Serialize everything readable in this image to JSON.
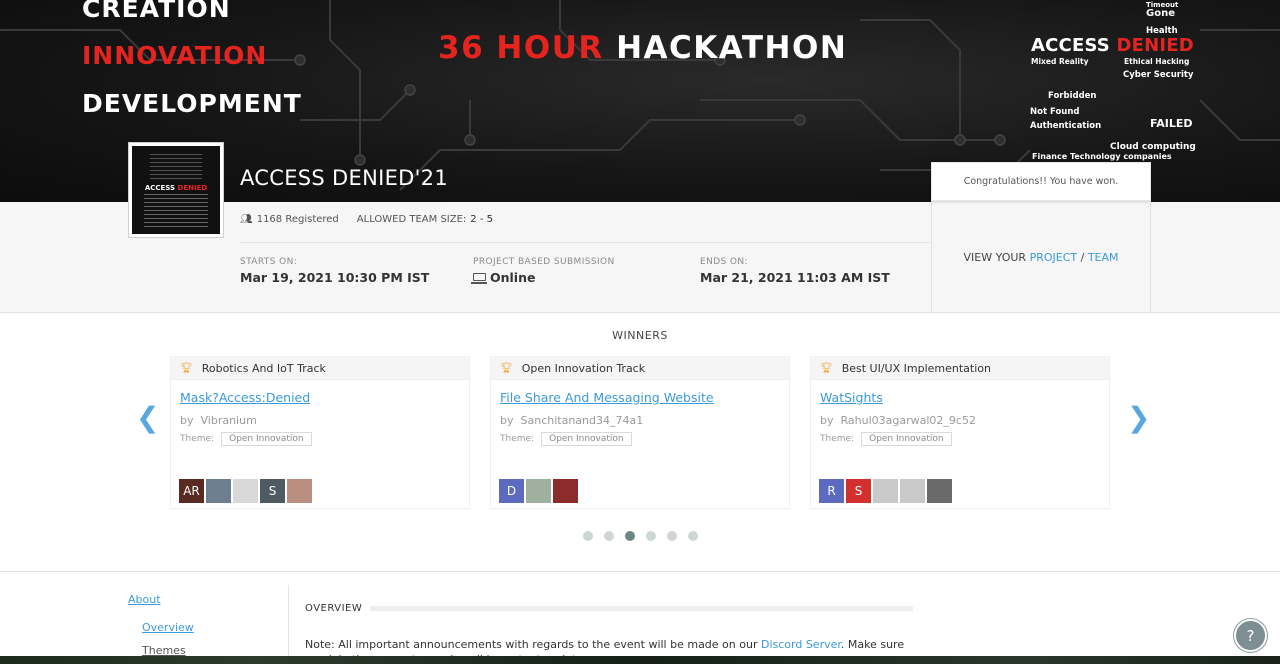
{
  "banner": {
    "tagline": [
      "CREATION",
      "INNOVATION",
      "DEVELOPMENT"
    ],
    "hackathon_number": "36 HOUR",
    "hackathon_word": "HACKATHON",
    "cloud_prefix": "ACCESS",
    "cloud_suffix": "DENIED",
    "cloud_words": [
      "Timeout",
      "Gone",
      "Health",
      "Mixed Reality",
      "Ethical Hacking",
      "Cyber Security",
      "Forbidden",
      "Not Found",
      "FAILED",
      "Authentication",
      "Cloud computing",
      "Finance Technology companies"
    ]
  },
  "event": {
    "name": "ACCESS DENIED'21",
    "logo_text_prefix": "ACCESS",
    "logo_text_suffix": "DENIED",
    "registered": "1168 Registered",
    "team_size_label": "ALLOWED TEAM SIZE:",
    "team_size_value": "2 - 5",
    "starts_label": "STARTS ON:",
    "starts_value": "Mar 19, 2021 10:30 PM IST",
    "submission_label": "PROJECT BASED SUBMISSION",
    "submission_value": "Online",
    "ends_label": "ENDS ON:",
    "ends_value": "Mar 21, 2021 11:03 AM IST"
  },
  "winbox": {
    "message": "Congratulations!! You have won.",
    "view_prefix": "VIEW YOUR",
    "project_link": "PROJECT",
    "separator": "/",
    "team_link": "TEAM"
  },
  "winners": {
    "title": "WINNERS",
    "cards": [
      {
        "track": "Robotics And IoT Track",
        "project": "Mask?Access:Denied",
        "by_label": "by",
        "author": "Vibranium",
        "theme_label": "Theme:",
        "theme": "Open Innovation",
        "avatars": [
          {
            "letter": "AR",
            "color": "#5a2a22"
          },
          {
            "letter": "",
            "color": "#6d7f8f"
          },
          {
            "letter": "",
            "color": "#d8d8d8"
          },
          {
            "letter": "S",
            "color": "#4f5b62"
          },
          {
            "letter": "",
            "color": "#b88f80"
          }
        ]
      },
      {
        "track": "Open Innovation Track",
        "project": "File Share And Messaging Website",
        "by_label": "by",
        "author": "Sanchitanand34_74a1",
        "theme_label": "Theme:",
        "theme": "Open Innovation",
        "avatars": [
          {
            "letter": "D",
            "color": "#5c6bc0"
          },
          {
            "letter": "",
            "color": "#9fb0a0"
          },
          {
            "letter": "",
            "color": "#8b2b2b"
          }
        ]
      },
      {
        "track": "Best UI/UX Implementation",
        "project": "WatSights",
        "by_label": "by",
        "author": "Rahul03agarwal02_9c52",
        "theme_label": "Theme:",
        "theme": "Open Innovation",
        "avatars": [
          {
            "letter": "R",
            "color": "#5c6bc0"
          },
          {
            "letter": "S",
            "color": "#d32f2f"
          },
          {
            "letter": "",
            "color": "#c9c9c9"
          },
          {
            "letter": "",
            "color": "#c9c9c9"
          },
          {
            "letter": "",
            "color": "#6a6a6a"
          }
        ]
      }
    ],
    "active_dot": 2,
    "dot_count": 6
  },
  "sidebar": {
    "about": "About",
    "items": [
      "Overview",
      "Themes"
    ]
  },
  "overview": {
    "heading": "OVERVIEW",
    "note_before": "Note: All important announcements with regards to the event will be made on our",
    "note_link": "Discord Server",
    "note_after": ". Make sure you join the server to receive all important updates."
  },
  "help": {
    "label": "?"
  },
  "colors": {
    "accent": "#3b9ad9",
    "brand_red": "#e52420",
    "trophy": "#f0a12a"
  }
}
